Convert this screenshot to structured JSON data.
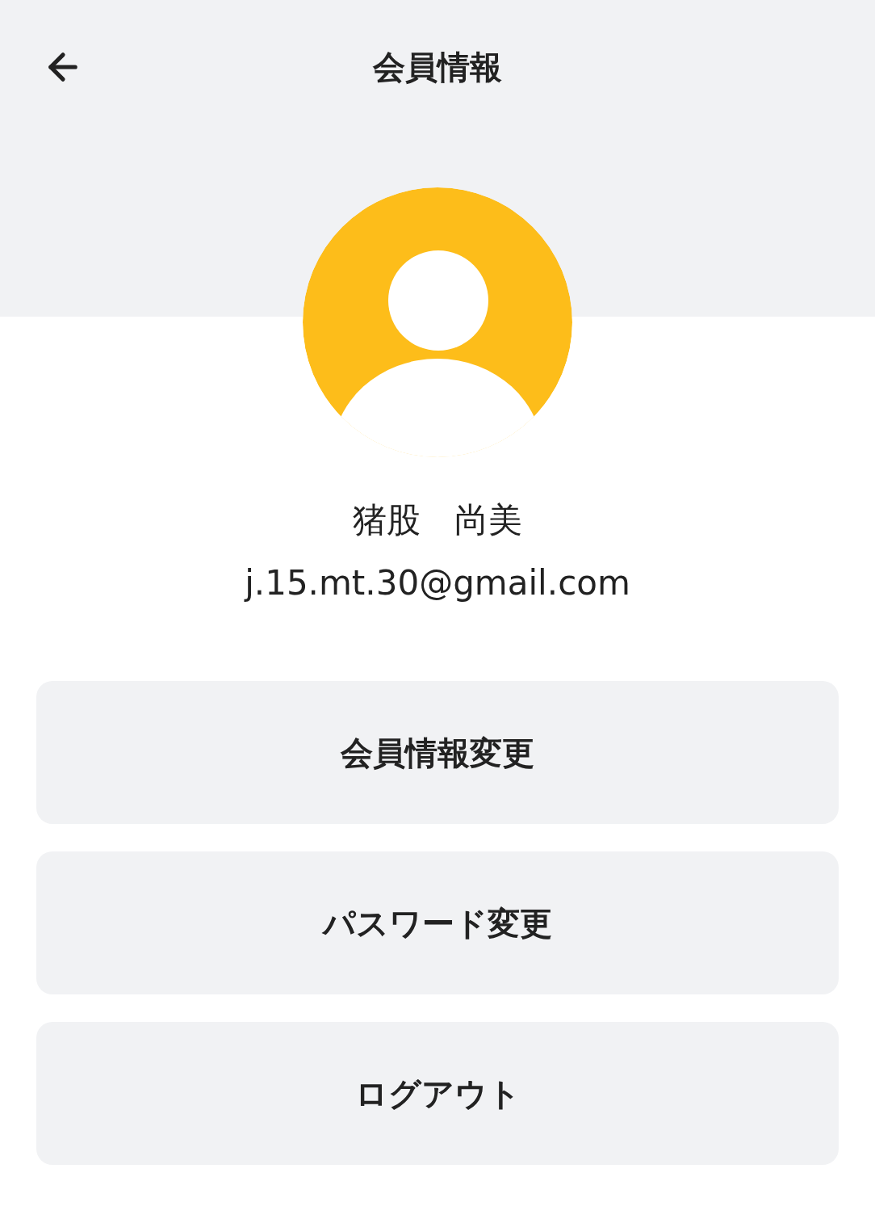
{
  "header": {
    "title": "会員情報"
  },
  "profile": {
    "name": "猪股　尚美",
    "email": "j.15.mt.30@gmail.com"
  },
  "buttons": [
    {
      "label": "会員情報変更"
    },
    {
      "label": "パスワード変更"
    },
    {
      "label": "ログアウト"
    }
  ]
}
